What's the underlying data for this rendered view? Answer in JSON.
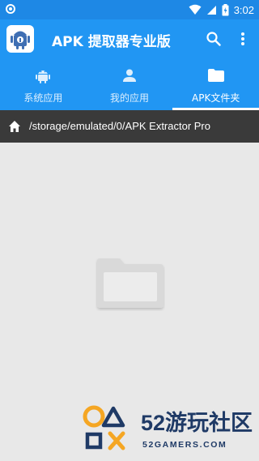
{
  "status_bar": {
    "time": "3:02"
  },
  "app_bar": {
    "title": "APK 提取器专业版"
  },
  "tabs": [
    {
      "label": "系统应用",
      "icon": "android-icon",
      "active": false
    },
    {
      "label": "我的应用",
      "icon": "person-icon",
      "active": false
    },
    {
      "label": "APK文件夹",
      "icon": "folder-icon",
      "active": true
    }
  ],
  "path_bar": {
    "path": "/storage/emulated/0/APK Extractor Pro"
  },
  "watermark": {
    "big": "52游玩社区",
    "small": "52GAMERS.COM"
  },
  "colors": {
    "primary": "#2196f3",
    "status": "#1e88e5",
    "path_bar": "#3a3a3a",
    "background": "#e8e8e8",
    "watermark_orange": "#f5a623",
    "watermark_navy": "#1f3a66"
  }
}
